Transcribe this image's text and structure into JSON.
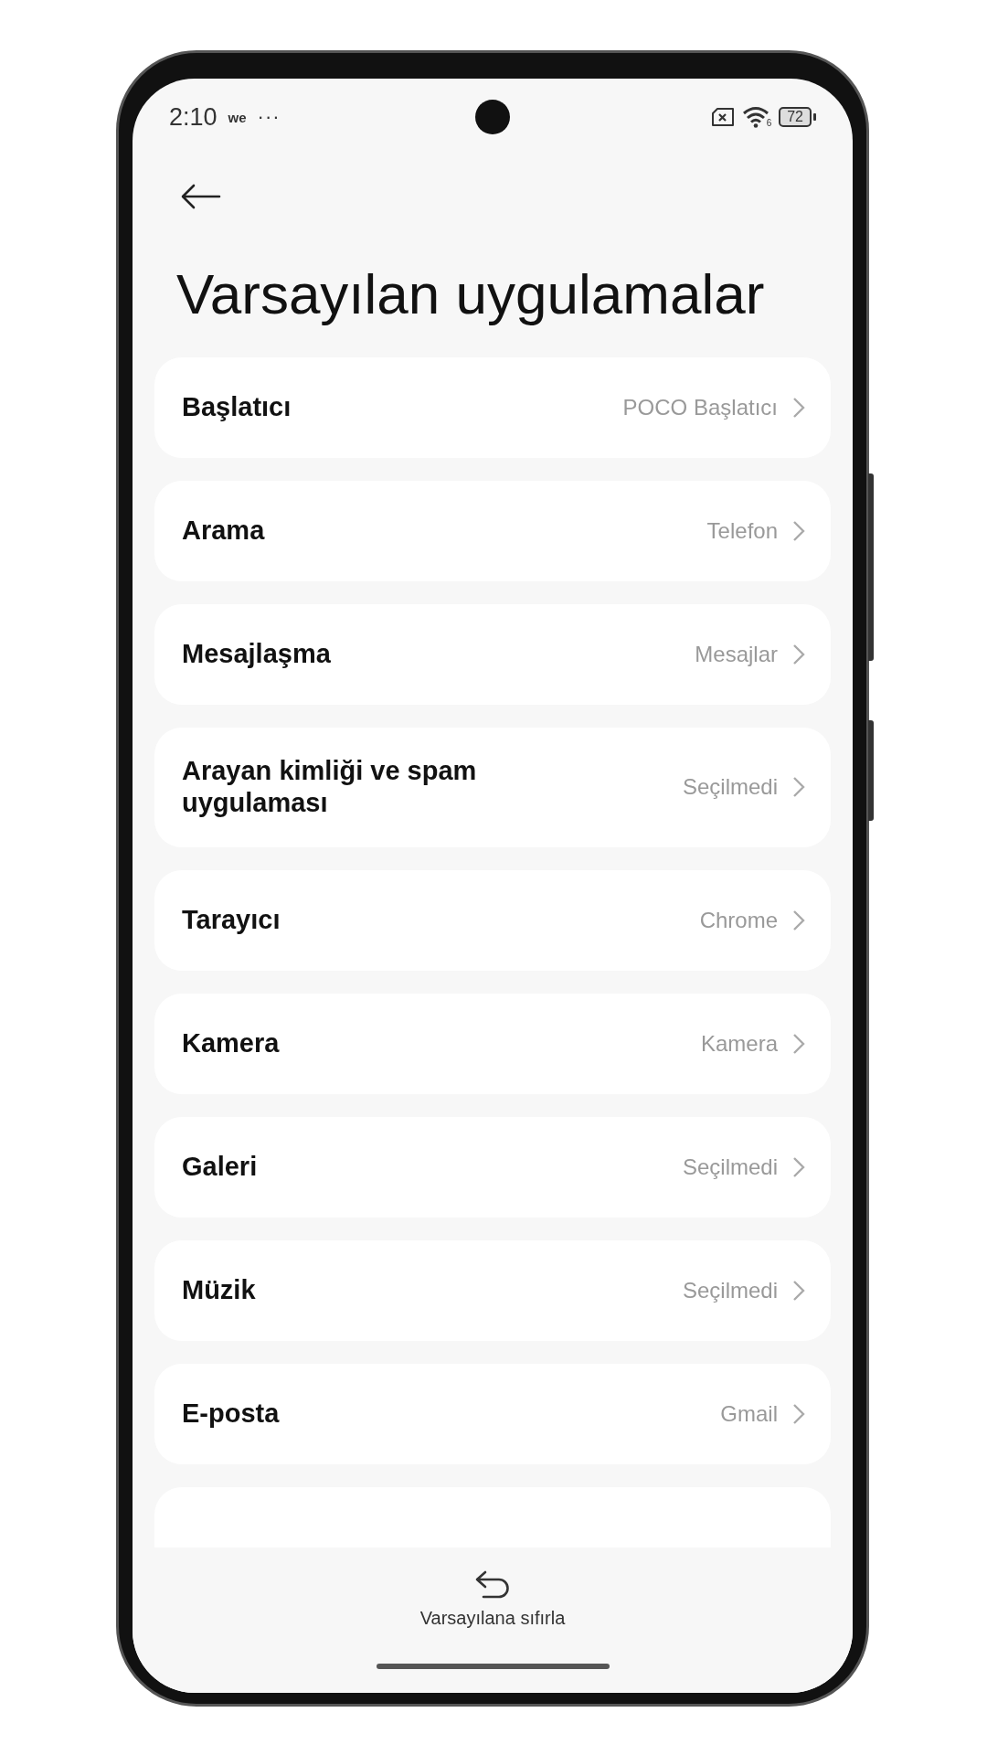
{
  "status_bar": {
    "time": "2:10",
    "carrier": "we",
    "more": "···",
    "wifi_level": "6",
    "battery": "72"
  },
  "title": "Varsayılan uygulamalar",
  "items": [
    {
      "label": "Başlatıcı",
      "value": "POCO Başlatıcı"
    },
    {
      "label": "Arama",
      "value": "Telefon"
    },
    {
      "label": "Mesajlaşma",
      "value": "Mesajlar"
    },
    {
      "label": "Arayan kimliği ve spam uygulaması",
      "value": "Seçilmedi"
    },
    {
      "label": "Tarayıcı",
      "value": "Chrome"
    },
    {
      "label": "Kamera",
      "value": "Kamera"
    },
    {
      "label": "Galeri",
      "value": "Seçilmedi"
    },
    {
      "label": "Müzik",
      "value": "Seçilmedi"
    },
    {
      "label": "E-posta",
      "value": "Gmail"
    }
  ],
  "bottom_action": {
    "label": "Varsayılana sıfırla"
  }
}
